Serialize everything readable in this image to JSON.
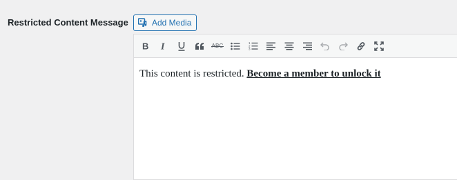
{
  "field": {
    "label": "Restricted Content Message"
  },
  "media": {
    "button_label": "Add Media",
    "icon": "media-icon"
  },
  "toolbar": {
    "buttons": [
      {
        "name": "bold",
        "icon": "bold-icon"
      },
      {
        "name": "italic",
        "icon": "italic-icon"
      },
      {
        "name": "underline",
        "icon": "underline-icon"
      },
      {
        "name": "blockquote",
        "icon": "quote-icon"
      },
      {
        "name": "strikethrough",
        "icon": "strikethrough-icon"
      },
      {
        "name": "bulleted-list",
        "icon": "bullet-list-icon"
      },
      {
        "name": "numbered-list",
        "icon": "numbered-list-icon"
      },
      {
        "name": "align-left",
        "icon": "align-left-icon"
      },
      {
        "name": "align-center",
        "icon": "align-center-icon"
      },
      {
        "name": "align-right",
        "icon": "align-right-icon"
      },
      {
        "name": "undo",
        "icon": "undo-icon"
      },
      {
        "name": "redo",
        "icon": "redo-icon"
      },
      {
        "name": "insert-link",
        "icon": "link-icon"
      },
      {
        "name": "fullscreen",
        "icon": "fullscreen-icon"
      }
    ],
    "strike_glyph": "ABC"
  },
  "editor": {
    "text": "This content is restricted.",
    "link_text": "Become a member to unlock it"
  },
  "colors": {
    "accent": "#2271b1",
    "icon": "#50575e",
    "disabled": "#a7aaad"
  }
}
